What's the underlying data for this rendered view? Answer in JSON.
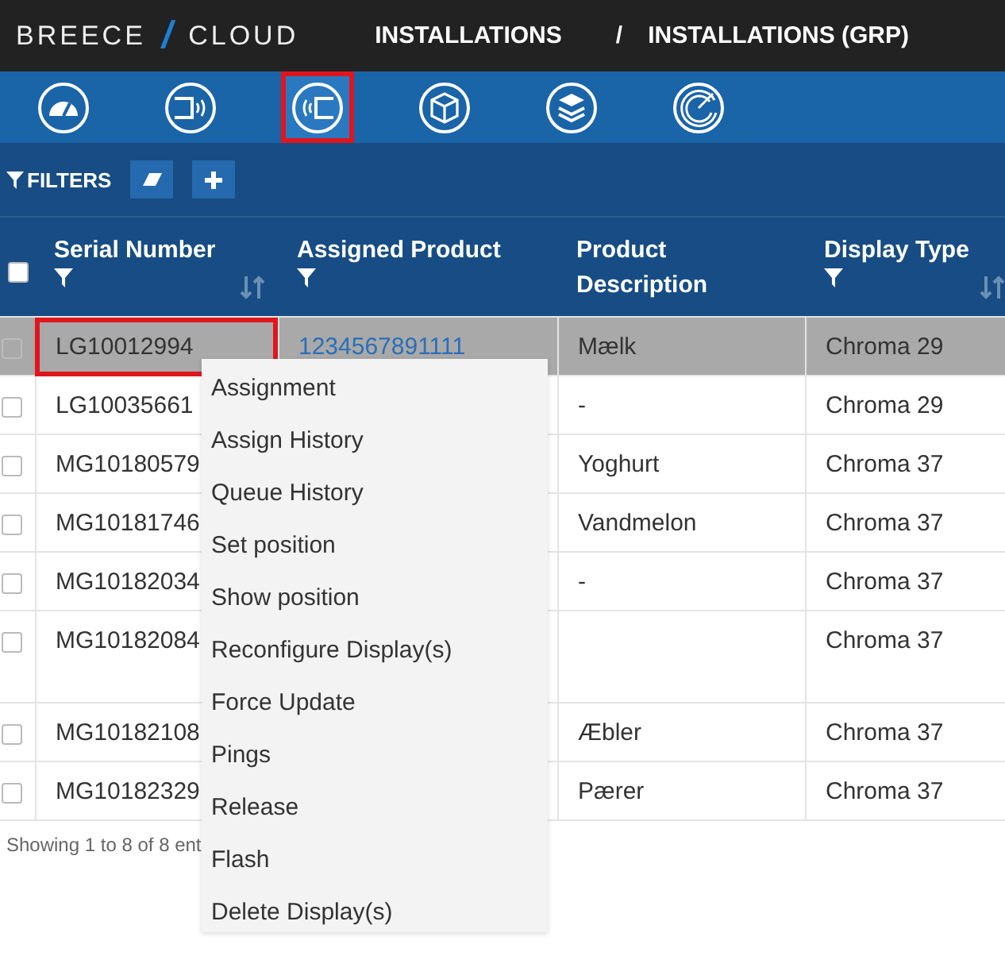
{
  "header": {
    "brand_left": "BREECE",
    "brand_sep": "/",
    "brand_right": "CLOUD",
    "breadcrumbs": [
      "INSTALLATIONS",
      "/",
      "INSTALLATIONS (GRP)"
    ]
  },
  "nav_icons": [
    {
      "kind": "gauge",
      "selected": false,
      "highlighted": false
    },
    {
      "kind": "device-out",
      "selected": false,
      "highlighted": false
    },
    {
      "kind": "device-in",
      "selected": true,
      "highlighted": true
    },
    {
      "kind": "box",
      "selected": false,
      "highlighted": false
    },
    {
      "kind": "layers",
      "selected": false,
      "highlighted": false
    },
    {
      "kind": "dial",
      "selected": false,
      "highlighted": false
    }
  ],
  "filters": {
    "label": "FILTERS"
  },
  "select_all": {
    "checked": false
  },
  "table": {
    "columns": [
      {
        "label": "Serial Number",
        "filter": true,
        "sort": true
      },
      {
        "label": "Assigned Product",
        "filter": true,
        "sort": false
      },
      {
        "label": "Product Description",
        "filter": false,
        "sort": false
      },
      {
        "label": "Display Type",
        "filter": true,
        "sort": true
      }
    ],
    "rows": [
      {
        "selected": true,
        "highlighted": true,
        "tall": false,
        "cells": [
          "LG10012994",
          "1234567891111",
          "Mælk",
          "Chroma 29"
        ]
      },
      {
        "selected": false,
        "highlighted": false,
        "tall": false,
        "cells": [
          "LG10035661",
          "",
          "-",
          "Chroma 29"
        ]
      },
      {
        "selected": false,
        "highlighted": false,
        "tall": false,
        "cells": [
          "MG10180579",
          "",
          "Yoghurt",
          "Chroma 37"
        ]
      },
      {
        "selected": false,
        "highlighted": false,
        "tall": false,
        "cells": [
          "MG10181746",
          "",
          "Vandmelon",
          "Chroma 37"
        ]
      },
      {
        "selected": false,
        "highlighted": false,
        "tall": false,
        "cells": [
          "MG10182034",
          "",
          "-",
          "Chroma 37"
        ]
      },
      {
        "selected": false,
        "highlighted": false,
        "tall": true,
        "cells": [
          "MG10182084",
          "",
          "",
          "Chroma 37"
        ]
      },
      {
        "selected": false,
        "highlighted": false,
        "tall": false,
        "cells": [
          "MG10182108",
          "",
          "Æbler",
          "Chroma 37"
        ]
      },
      {
        "selected": false,
        "highlighted": false,
        "tall": false,
        "cells": [
          "MG10182329",
          "",
          "Pærer",
          "Chroma 37"
        ]
      }
    ]
  },
  "footer": "Showing 1 to 8 of 8 ent",
  "context_menu": [
    "Assignment",
    "Assign History",
    "Queue History",
    "Set position",
    "Show position",
    "Reconfigure Display(s)",
    "Force Update",
    "Pings",
    "Release",
    "Flash",
    "Delete Display(s)"
  ]
}
